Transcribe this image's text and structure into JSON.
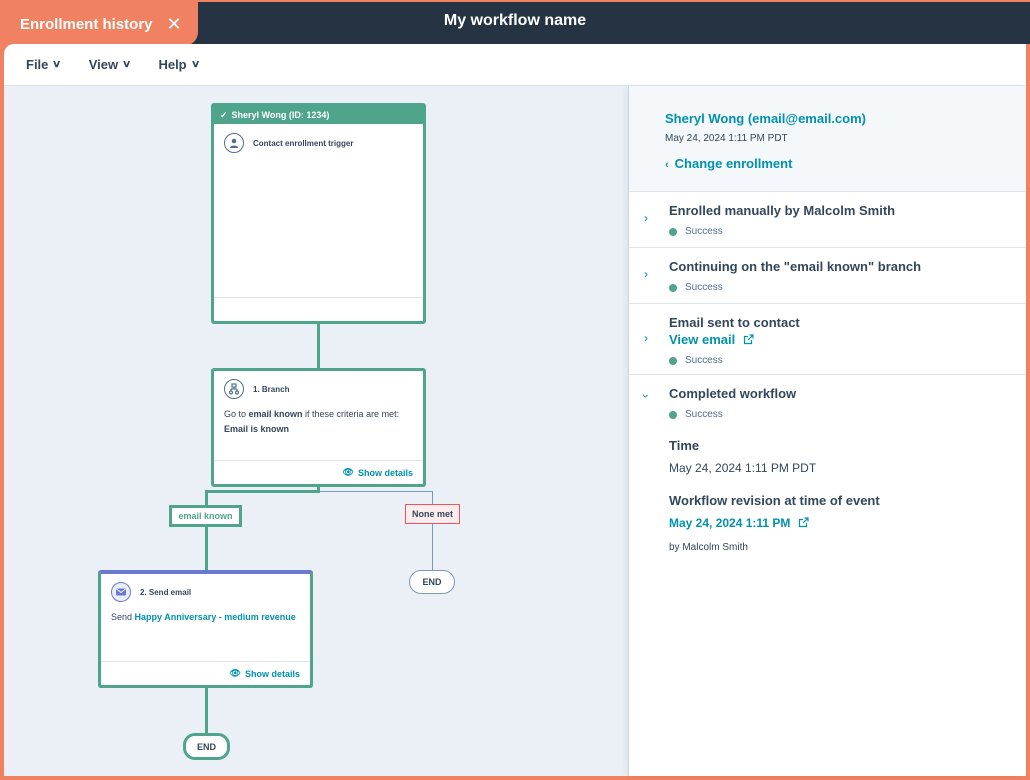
{
  "header": {
    "tab_label": "Enrollment history",
    "tab_close_icon": "close-icon",
    "workflow_title": "My workflow name"
  },
  "menu": [
    {
      "label": "File",
      "icon": "chevron-down-icon"
    },
    {
      "label": "View",
      "icon": "chevron-down-icon"
    },
    {
      "label": "Help",
      "icon": "chevron-down-icon"
    }
  ],
  "canvas": {
    "trigger_card": {
      "header": "Sheryl Wong (ID: 1234)",
      "header_icon": "check-icon",
      "icon": "contact-icon",
      "label": "Contact enrollment trigger"
    },
    "branch_card": {
      "icon": "branch-icon",
      "title": "1. Branch",
      "text_prefix": "Go to ",
      "text_bold": "email known",
      "text_suffix": " if these criteria are met:",
      "criteria": "Email is known",
      "show_details": "Show details"
    },
    "branches": [
      {
        "label": "email known",
        "status": "taken"
      },
      {
        "label": "None met",
        "status": "not-taken"
      }
    ],
    "email_card": {
      "icon": "email-icon",
      "title": "2. Send email",
      "text_prefix": "Send ",
      "email_name": "Happy Anniversary - medium revenue",
      "show_details": "Show details"
    },
    "end_labels": [
      "END",
      "END"
    ]
  },
  "panel": {
    "contact": "Sheryl Wong (email@email.com)",
    "enrolled_date": "May 24, 2024 1:11 PM PDT",
    "change_enrollment": "Change enrollment",
    "events": [
      {
        "title": "Enrolled manually by Malcolm Smith",
        "status": "Success",
        "expanded": false
      },
      {
        "title": "Continuing on the \"email known\" branch",
        "status": "Success",
        "expanded": false
      },
      {
        "title": "Email sent to contact",
        "link": "View email",
        "status": "Success",
        "expanded": false
      },
      {
        "title": "Completed workflow",
        "status": "Success",
        "expanded": true
      }
    ],
    "details": {
      "time_label": "Time",
      "time_value": "May 24, 2024 1:11 PM PDT",
      "revision_label": "Workflow revision at time of event",
      "revision_link": "May 24, 2024 1:11 PM",
      "revision_by": "by Malcolm Smith"
    }
  },
  "colors": {
    "accent_orange": "#f08261",
    "topbar": "#253342",
    "success_green": "#4fa48c",
    "link_teal": "#0091ae"
  }
}
